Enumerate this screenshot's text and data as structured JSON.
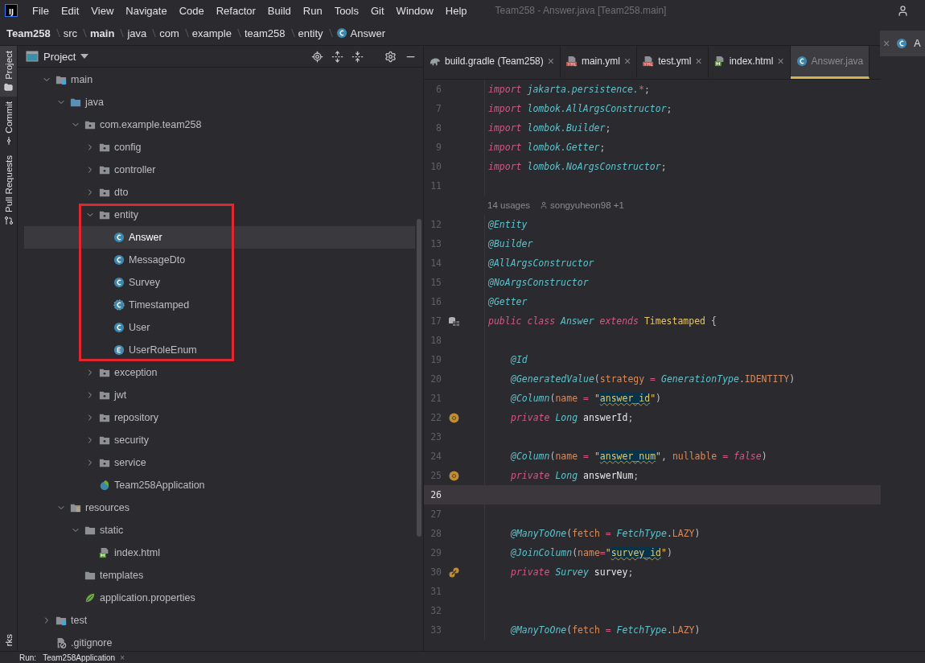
{
  "menu_bar": {
    "logo": "IJ",
    "items": [
      "File",
      "Edit",
      "View",
      "Navigate",
      "Code",
      "Refactor",
      "Build",
      "Run",
      "Tools",
      "Git",
      "Window",
      "Help"
    ],
    "title": "Team258 - Answer.java [Team258.main]"
  },
  "breadcrumb": [
    {
      "label": "Team258",
      "bold": true
    },
    {
      "label": "src",
      "bold": false
    },
    {
      "label": "main",
      "bold": true
    },
    {
      "label": "java",
      "bold": false
    },
    {
      "label": "com",
      "bold": false
    },
    {
      "label": "example",
      "bold": false
    },
    {
      "label": "team258",
      "bold": false
    },
    {
      "label": "entity",
      "bold": false
    },
    {
      "label": "Answer",
      "bold": false,
      "kind": "class"
    }
  ],
  "tool_stripe": [
    {
      "label": "Project",
      "kind": "folder",
      "selected": true
    },
    {
      "label": "Commit",
      "kind": "commit",
      "selected": false
    },
    {
      "label": "Pull Requests",
      "kind": "pull",
      "selected": false
    }
  ],
  "tool_stripe_bottom": "rks",
  "project_panel": {
    "title": "Project",
    "tree": [
      {
        "label": "main",
        "kind": "module",
        "expanded": true,
        "selected": false,
        "children": [
          {
            "label": "java",
            "kind": "source",
            "expanded": true,
            "selected": false,
            "children": [
              {
                "label": "com.example.team258",
                "kind": "package",
                "expanded": true,
                "selected": false,
                "children": [
                  {
                    "label": "config",
                    "kind": "package",
                    "expanded": false,
                    "selected": false
                  },
                  {
                    "label": "controller",
                    "kind": "package",
                    "expanded": false,
                    "selected": false
                  },
                  {
                    "label": "dto",
                    "kind": "package",
                    "expanded": false,
                    "selected": false
                  },
                  {
                    "label": "entity",
                    "kind": "package",
                    "expanded": true,
                    "selected": false,
                    "framed": true,
                    "children": [
                      {
                        "label": "Answer",
                        "kind": "class",
                        "selected": true
                      },
                      {
                        "label": "MessageDto",
                        "kind": "class",
                        "selected": false
                      },
                      {
                        "label": "Survey",
                        "kind": "class",
                        "selected": false
                      },
                      {
                        "label": "Timestamped",
                        "kind": "abstract",
                        "selected": false
                      },
                      {
                        "label": "User",
                        "kind": "class",
                        "selected": false
                      },
                      {
                        "label": "UserRoleEnum",
                        "kind": "enum",
                        "selected": false
                      }
                    ]
                  },
                  {
                    "label": "exception",
                    "kind": "package",
                    "expanded": false,
                    "selected": false
                  },
                  {
                    "label": "jwt",
                    "kind": "package",
                    "expanded": false,
                    "selected": false
                  },
                  {
                    "label": "repository",
                    "kind": "package",
                    "expanded": false,
                    "selected": false
                  },
                  {
                    "label": "security",
                    "kind": "package",
                    "expanded": false,
                    "selected": false
                  },
                  {
                    "label": "service",
                    "kind": "package",
                    "expanded": false,
                    "selected": false
                  },
                  {
                    "label": "Team258Application",
                    "kind": "spring",
                    "selected": false
                  }
                ]
              }
            ]
          },
          {
            "label": "resources",
            "kind": "resources",
            "expanded": true,
            "selected": false,
            "children": [
              {
                "label": "static",
                "kind": "folder",
                "expanded": true,
                "selected": false,
                "children": [
                  {
                    "label": "index.html",
                    "kind": "html",
                    "selected": false
                  }
                ]
              },
              {
                "label": "templates",
                "kind": "folder",
                "selected": false
              },
              {
                "label": "application.properties",
                "kind": "properties",
                "selected": false
              }
            ]
          }
        ]
      },
      {
        "label": "test",
        "kind": "module",
        "expanded": false,
        "selected": false
      },
      {
        "label": ".gitignore",
        "kind": "ignore",
        "selected": false
      }
    ]
  },
  "editor_tabs": [
    {
      "label": "build.gradle (Team258)",
      "kind": "gradle",
      "selected": false,
      "close": "×"
    },
    {
      "label": "main.yml",
      "kind": "yml",
      "selected": false,
      "close": "×"
    },
    {
      "label": "test.yml",
      "kind": "yml",
      "selected": false,
      "close": "×"
    },
    {
      "label": "index.html",
      "kind": "html",
      "selected": false,
      "close": "×"
    },
    {
      "label": "Answer.java",
      "kind": "class",
      "selected": true
    }
  ],
  "code_lines": [
    {
      "kind": "code",
      "num": "6",
      "tokens": [
        {
          "kind": "kw",
          "t": "import"
        },
        {
          "kind": "pkg",
          "t": " jakarta.persistence."
        },
        {
          "kind": "kw",
          "t": "*"
        },
        {
          "kind": "punct",
          "t": ";"
        }
      ]
    },
    {
      "kind": "code",
      "num": "7",
      "tokens": [
        {
          "kind": "kw",
          "t": "import"
        },
        {
          "kind": "pkg",
          "t": " lombok.AllArgsConstructor"
        },
        {
          "kind": "punct",
          "t": ";"
        }
      ]
    },
    {
      "kind": "code",
      "num": "8",
      "tokens": [
        {
          "kind": "kw",
          "t": "import"
        },
        {
          "kind": "pkg",
          "t": " lombok.Builder"
        },
        {
          "kind": "punct",
          "t": ";"
        }
      ]
    },
    {
      "kind": "code",
      "num": "9",
      "tokens": [
        {
          "kind": "kw",
          "t": "import"
        },
        {
          "kind": "pkg",
          "t": " lombok.Getter"
        },
        {
          "kind": "punct",
          "t": ";"
        }
      ]
    },
    {
      "kind": "code",
      "num": "10",
      "tokens": [
        {
          "kind": "kw",
          "t": "import"
        },
        {
          "kind": "pkg",
          "t": " lombok.NoArgsConstructor"
        },
        {
          "kind": "punct",
          "t": ";"
        }
      ]
    },
    {
      "kind": "code",
      "num": "11"
    },
    {
      "kind": "inlay",
      "usages": "14 usages",
      "author": "songyuheon98 +1"
    },
    {
      "kind": "code",
      "num": "12",
      "tokens": [
        {
          "kind": "ann",
          "t": "@Entity"
        }
      ]
    },
    {
      "kind": "code",
      "num": "13",
      "tokens": [
        {
          "kind": "ann",
          "t": "@Builder"
        }
      ]
    },
    {
      "kind": "code",
      "num": "14",
      "tokens": [
        {
          "kind": "ann",
          "t": "@AllArgsConstructor"
        }
      ]
    },
    {
      "kind": "code",
      "num": "15",
      "tokens": [
        {
          "kind": "ann",
          "t": "@NoArgsConstructor"
        }
      ]
    },
    {
      "kind": "code",
      "num": "16",
      "tokens": [
        {
          "kind": "ann",
          "t": "@Getter"
        }
      ]
    },
    {
      "kind": "code",
      "num": "17",
      "gutter": {
        "kind": "table"
      },
      "tokens": [
        {
          "kind": "kw",
          "t": "public class "
        },
        {
          "kind": "type",
          "t": "Answer"
        },
        {
          "kind": "kw",
          "t": " extends "
        },
        {
          "kind": "cls",
          "t": "Timestamped"
        },
        {
          "kind": "punct",
          "t": " {"
        }
      ]
    },
    {
      "kind": "code",
      "num": "18"
    },
    {
      "kind": "code",
      "num": "19",
      "indent": true,
      "tokens": [
        {
          "kind": "ann",
          "t": "@Id"
        }
      ]
    },
    {
      "kind": "code",
      "num": "20",
      "indent": true,
      "tokens": [
        {
          "kind": "ann",
          "t": "@GeneratedValue"
        },
        {
          "kind": "punct",
          "t": "("
        },
        {
          "kind": "param",
          "t": "strategy"
        },
        {
          "kind": "kw",
          "t": " = "
        },
        {
          "kind": "type",
          "t": "GenerationType"
        },
        {
          "kind": "punct",
          "t": "."
        },
        {
          "kind": "param",
          "t": "IDENTITY"
        },
        {
          "kind": "punct",
          "t": ")"
        }
      ]
    },
    {
      "kind": "code",
      "num": "21",
      "indent": true,
      "tokens": [
        {
          "kind": "ann",
          "t": "@Column"
        },
        {
          "kind": "punct",
          "t": "("
        },
        {
          "kind": "param",
          "t": "name"
        },
        {
          "kind": "kw",
          "t": " = "
        },
        {
          "kind": "str",
          "t": "\""
        },
        {
          "kind": "strhl",
          "t": "answer_id"
        },
        {
          "kind": "str",
          "t": "\""
        },
        {
          "kind": "punct",
          "t": ")"
        }
      ]
    },
    {
      "kind": "code",
      "num": "22",
      "gutter": {
        "kind": "bean"
      },
      "indent": true,
      "tokens": [
        {
          "kind": "kw",
          "t": "private "
        },
        {
          "kind": "type",
          "t": "Long"
        },
        {
          "kind": "ident",
          "t": " answerId"
        },
        {
          "kind": "punct",
          "t": ";"
        }
      ]
    },
    {
      "kind": "code",
      "num": "23"
    },
    {
      "kind": "code",
      "num": "24",
      "indent": true,
      "tokens": [
        {
          "kind": "ann",
          "t": "@Column"
        },
        {
          "kind": "punct",
          "t": "("
        },
        {
          "kind": "param",
          "t": "name"
        },
        {
          "kind": "kw",
          "t": " = "
        },
        {
          "kind": "str",
          "t": "\""
        },
        {
          "kind": "strhl",
          "t": "answer_num"
        },
        {
          "kind": "str",
          "t": "\""
        },
        {
          "kind": "punct",
          "t": ", "
        },
        {
          "kind": "param",
          "t": "nullable"
        },
        {
          "kind": "kw",
          "t": " = false"
        },
        {
          "kind": "punct",
          "t": ")"
        }
      ]
    },
    {
      "kind": "code",
      "num": "25",
      "gutter": {
        "kind": "bean"
      },
      "indent": true,
      "tokens": [
        {
          "kind": "kw",
          "t": "private "
        },
        {
          "kind": "type",
          "t": "Long"
        },
        {
          "kind": "ident",
          "t": " answerNum"
        },
        {
          "kind": "punct",
          "t": ";"
        }
      ]
    },
    {
      "kind": "code",
      "num": "26",
      "current": true
    },
    {
      "kind": "code",
      "num": "27"
    },
    {
      "kind": "code",
      "num": "28",
      "indent": true,
      "tokens": [
        {
          "kind": "ann",
          "t": "@ManyToOne"
        },
        {
          "kind": "punct",
          "t": "("
        },
        {
          "kind": "param",
          "t": "fetch"
        },
        {
          "kind": "kw",
          "t": " = "
        },
        {
          "kind": "type",
          "t": "FetchType"
        },
        {
          "kind": "punct",
          "t": "."
        },
        {
          "kind": "param",
          "t": "LAZY"
        },
        {
          "kind": "punct",
          "t": ")"
        }
      ]
    },
    {
      "kind": "code",
      "num": "29",
      "indent": true,
      "tokens": [
        {
          "kind": "ann",
          "t": "@JoinColumn"
        },
        {
          "kind": "punct",
          "t": "("
        },
        {
          "kind": "param",
          "t": "name"
        },
        {
          "kind": "kw",
          "t": "="
        },
        {
          "kind": "str",
          "t": "\""
        },
        {
          "kind": "strhl",
          "t": "survey_id"
        },
        {
          "kind": "str",
          "t": "\""
        },
        {
          "kind": "punct",
          "t": ")"
        }
      ]
    },
    {
      "kind": "code",
      "num": "30",
      "gutter": {
        "kind": "link"
      },
      "indent": true,
      "tokens": [
        {
          "kind": "kw",
          "t": "private "
        },
        {
          "kind": "type",
          "t": "Survey"
        },
        {
          "kind": "ident",
          "t": " survey"
        },
        {
          "kind": "punct",
          "t": ";"
        }
      ]
    },
    {
      "kind": "code",
      "num": "31"
    },
    {
      "kind": "code",
      "num": "32"
    },
    {
      "kind": "code",
      "num": "33",
      "indent": true,
      "tokens": [
        {
          "kind": "ann",
          "t": "@ManyToOne"
        },
        {
          "kind": "punct",
          "t": "("
        },
        {
          "kind": "param",
          "t": "fetch"
        },
        {
          "kind": "kw",
          "t": " = "
        },
        {
          "kind": "type",
          "t": "FetchType"
        },
        {
          "kind": "punct",
          "t": "."
        },
        {
          "kind": "param",
          "t": "LAZY"
        },
        {
          "kind": "punct",
          "t": ")"
        }
      ]
    }
  ],
  "side_editor_tab": {
    "close": "×",
    "label": "A",
    "kind": "class"
  },
  "bottom_bar": {
    "label": "Run:",
    "tab": "Team258Application",
    "close": "×"
  }
}
